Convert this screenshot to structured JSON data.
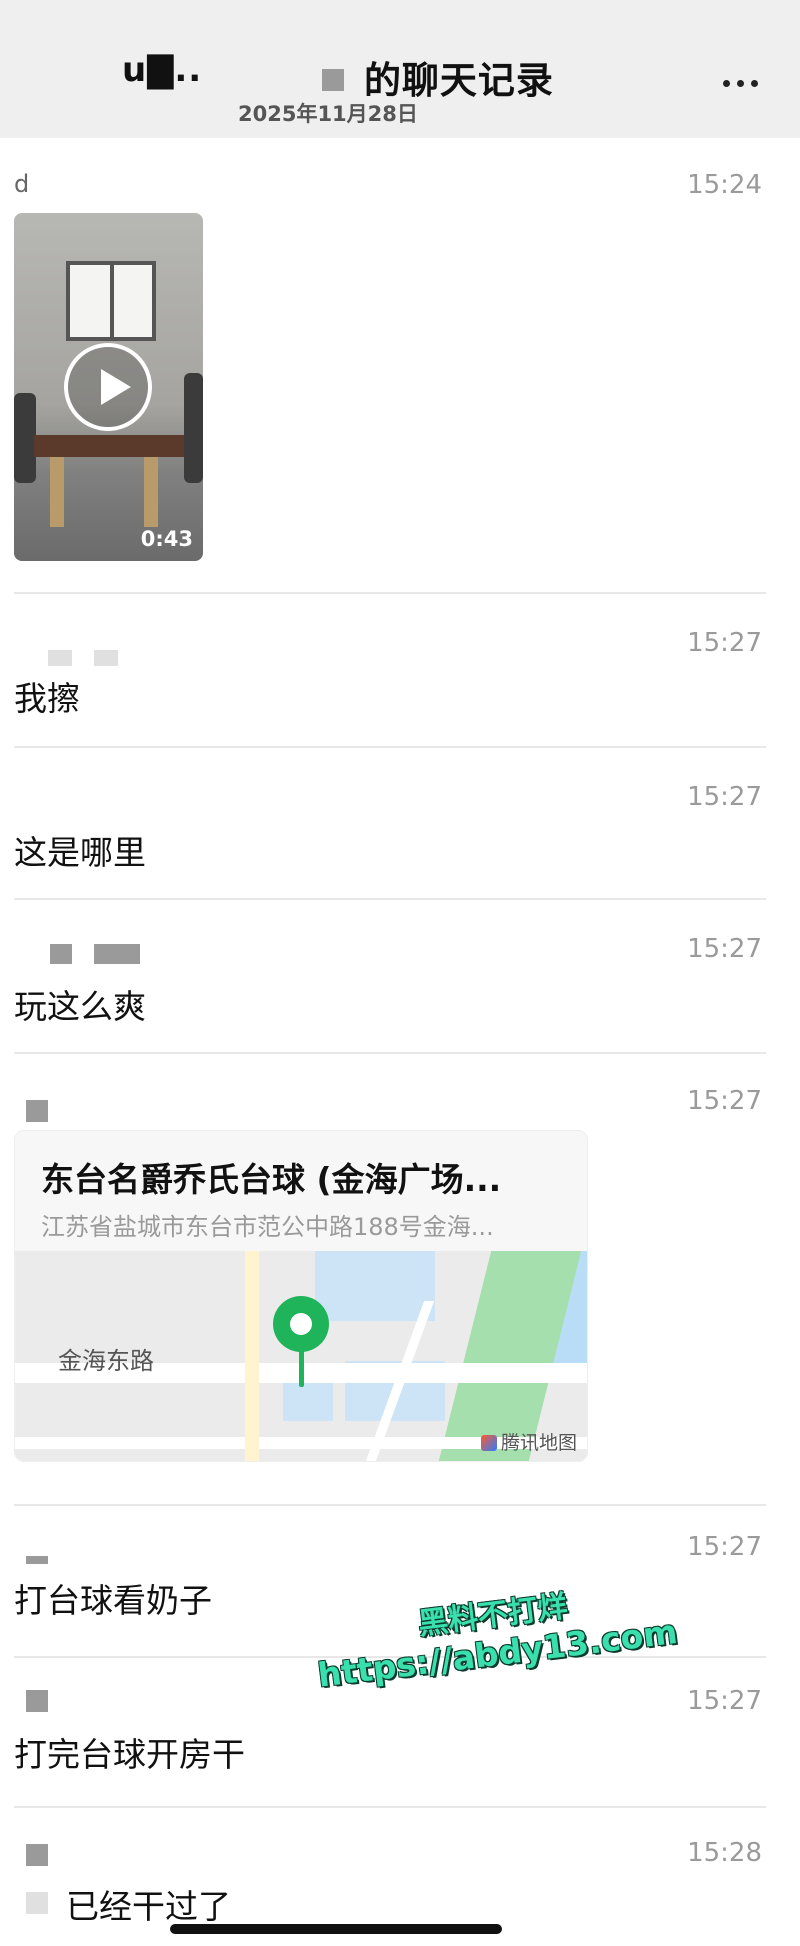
{
  "header": {
    "title_lead": "u▇..",
    "title": "的聊天记录",
    "date": "2025年11月28日",
    "more_label": "•••"
  },
  "messages": [
    {
      "sender": "d",
      "time": "15:24",
      "type": "video",
      "duration": "0:43"
    },
    {
      "time": "15:27",
      "text": "我擦"
    },
    {
      "time": "15:27",
      "text": "这是哪里"
    },
    {
      "time": "15:27",
      "text": "玩这么爽"
    },
    {
      "time": "15:27",
      "type": "location",
      "location": {
        "name": "东台名爵乔氏台球 (金海广场...",
        "address": "江苏省盐城市东台市范公中路188号金海...",
        "map_label": "金海东路",
        "map_brand": "腾讯地图"
      }
    },
    {
      "time": "15:27",
      "text": "打台球看奶子"
    },
    {
      "time": "15:27",
      "text": "打完台球开房干"
    },
    {
      "time": "15:28",
      "text": "已经干过了"
    }
  ],
  "watermark": {
    "line1": "黑料不打烊",
    "line2": "https://abdy13.com"
  }
}
